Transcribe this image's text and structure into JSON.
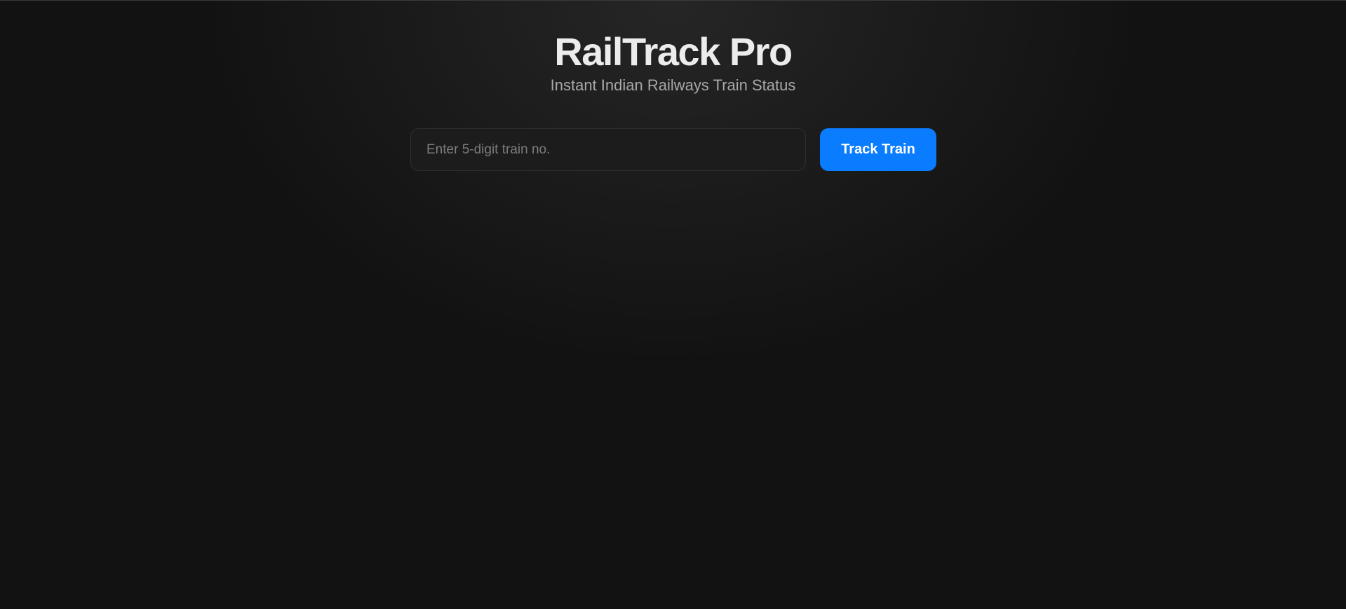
{
  "app": {
    "title": "RailTrack Pro",
    "subtitle": "Instant Indian Railways Train Status"
  },
  "search": {
    "placeholder": "Enter 5-digit train no.",
    "value": "",
    "button_label": "Track Train"
  },
  "colors": {
    "accent": "#0a7cff",
    "background": "#121212",
    "input_background": "#1c1c1c"
  }
}
